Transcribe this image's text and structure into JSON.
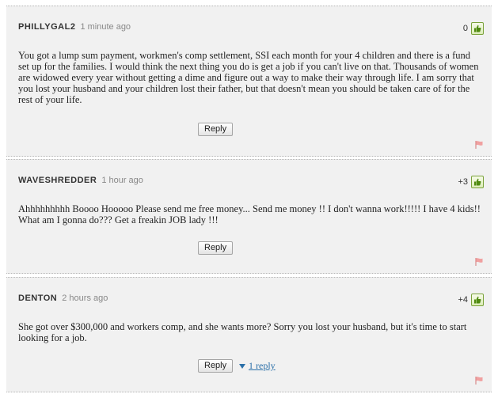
{
  "comments": [
    {
      "username": "PHILLYGAL2",
      "timestamp": "1 minute ago",
      "votes": "0",
      "text": "You got a lump sum payment, workmen's comp settlement, SSI each month for your 4 children and there is a fund set up for the families. I would think the next thing you do is get a job if you can't live on that. Thousands of women are widowed every year without getting a dime and figure out a way to make their way through life. I am sorry that you lost your husband and your children lost their father, but that doesn't mean you should be taken care of for the rest of your life.",
      "reply_label": "Reply"
    },
    {
      "username": "WAVESHREDDER",
      "timestamp": "1 hour ago",
      "votes": "+3",
      "text": "Ahhhhhhhhh Boooo Hooooo Please send me free money... Send me money !! I don't wanna work!!!!! I have 4 kids!! What am I gonna do??? Get a freakin JOB lady !!!",
      "reply_label": "Reply"
    },
    {
      "username": "DENTON",
      "timestamp": "2 hours ago",
      "votes": "+4",
      "text": "She got over $300,000 and workers comp, and she wants more? Sorry you lost your husband, but it's time to start looking for a job.",
      "reply_label": "Reply",
      "replies_link": "1 reply"
    }
  ],
  "icons": {
    "thumb": "thumbs-up-icon",
    "flag": "flag-icon",
    "expand": "triangle-down-icon"
  },
  "colors": {
    "background": "#f1f1f1",
    "link": "#2a6fa8",
    "thumb_border": "#7aa23a",
    "flag": "#e88a8a"
  }
}
